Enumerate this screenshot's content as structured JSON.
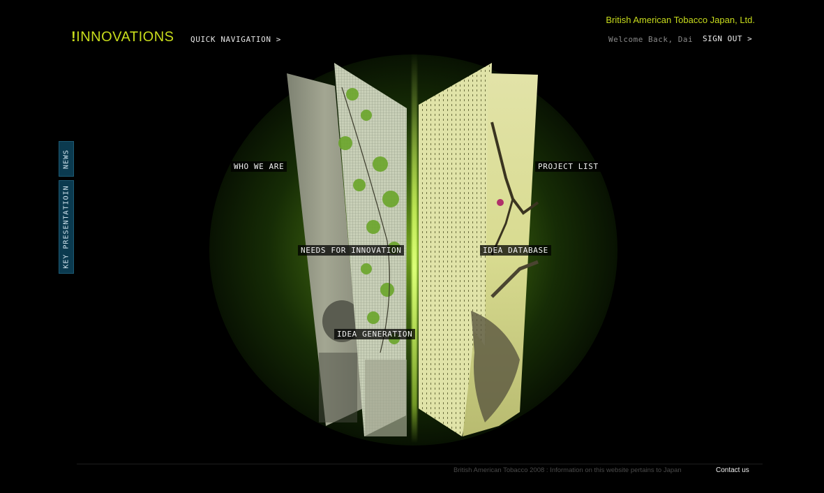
{
  "header": {
    "logo_mark": "!",
    "logo_text": "INNOVATIONS",
    "quick_nav_label": "QUICK NAVIGATION >",
    "company_name": "British American Tobacco Japan, Ltd.",
    "welcome_text": "Welcome Back, Dai",
    "sign_out_label": "SIGN OUT >"
  },
  "side_tabs": [
    {
      "label": "NEWS"
    },
    {
      "label": "KEY PRESENTATIOIN"
    }
  ],
  "nav": {
    "who_we_are": "WHO WE ARE",
    "project_list": "PROJECT LIST",
    "needs_for_innovation": "NEEDS FOR INNOVATION",
    "idea_database": "IDEA DATABASE",
    "idea_generation": "IDEA GENERATION"
  },
  "footer": {
    "copyright": "British American Tobacco 2008 : Information on this website pertains to Japan",
    "contact_label": "Contact us"
  },
  "colors": {
    "accent": "#c8dc1c",
    "glow": "#6aa81c",
    "tab_bg": "#0b3a4f",
    "background": "#000000"
  }
}
